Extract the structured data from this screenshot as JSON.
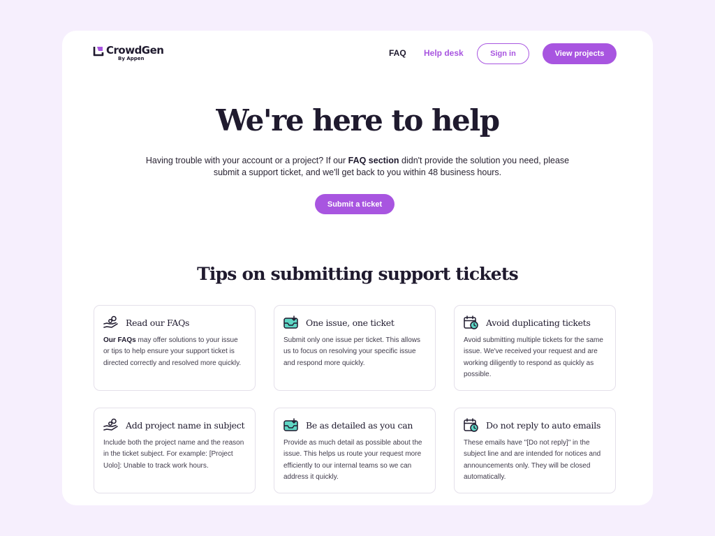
{
  "brand": {
    "name": "CrowdGen",
    "sub": "By Appen",
    "accent": "#a855e0"
  },
  "nav": {
    "faq": "FAQ",
    "help_desk": "Help desk",
    "sign_in": "Sign in",
    "view_projects": "View projects"
  },
  "hero": {
    "title": "We're here to help",
    "text_before": "Having trouble with your account or a project? If our ",
    "text_bold": "FAQ section",
    "text_after": " didn't provide the solution you need, please submit a support ticket, and we'll get back to you within 48 business hours.",
    "submit_label": "Submit a ticket"
  },
  "tips": {
    "title": "Tips on submitting support tickets",
    "items": [
      {
        "icon": "hand-coins-icon",
        "title": "Read our FAQs",
        "body_bold": "Our FAQs",
        "body": " may offer solutions to your issue or tips to help ensure your support ticket is directed correctly and resolved more quickly."
      },
      {
        "icon": "inbox-download-icon",
        "title": "One issue, one ticket",
        "body_bold": "",
        "body": "Submit only one issue per ticket. This allows us to focus on resolving your specific issue and respond more quickly."
      },
      {
        "icon": "calendar-clock-icon",
        "title": "Avoid duplicating tickets",
        "body_bold": "",
        "body": "Avoid submitting multiple tickets for the same issue. We've received your request and are working diligently to respond as quickly as possible."
      },
      {
        "icon": "hand-coins-icon",
        "title": "Add project name in subject",
        "body_bold": "",
        "body": "Include both the project name and the reason in the ticket subject. For example: [Project Uolo]: Unable to track work hours."
      },
      {
        "icon": "inbox-download-icon",
        "title": "Be as detailed as you can",
        "body_bold": "",
        "body": "Provide as much detail as possible about the issue. This helps us route your request more efficiently to our internal teams so we can address it quickly."
      },
      {
        "icon": "calendar-clock-icon",
        "title": "Do not reply to auto emails",
        "body_bold": "",
        "body": "These emails have \"[Do not reply]\" in the subject line and are intended for notices and announcements only. They will be closed automatically."
      }
    ]
  }
}
